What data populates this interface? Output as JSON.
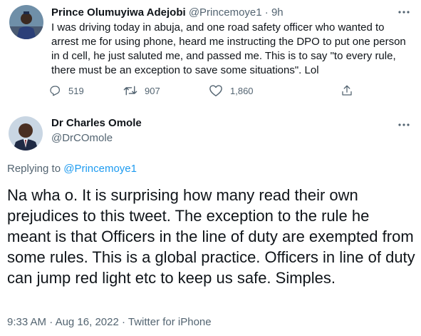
{
  "tweet1": {
    "author_name": "Prince Olumuyiwa Adejobi",
    "handle": "@Princemoye1",
    "separator": "·",
    "time": "9h",
    "text": "I was driving today in abuja, and one road safety officer who wanted to arrest me for using phone, heard me instructing the DPO to put one person in d cell, he just saluted me, and passed me. This is to say \"to every rule, there must be an exception to save some situations\". Lol",
    "reply_count": "519",
    "retweet_count": "907",
    "like_count": "1,860"
  },
  "tweet2": {
    "author_name": "Dr Charles Omole",
    "handle": "@DrCOmole",
    "replying_prefix": "Replying to",
    "replying_handle": "@Princemoye1",
    "text": "Na wha o. It is surprising how many read their own prejudices to this tweet. The exception to the rule he meant is that Officers in the line of duty are exempted from some rules. This is a global practice. Officers in line of duty can jump red light etc to keep us safe. Simples.",
    "time": "9:33 AM",
    "separator": "·",
    "date": "Aug 16, 2022",
    "source": "Twitter for iPhone"
  },
  "colors": {
    "text_primary": "#0f1419",
    "text_secondary": "#536471",
    "link": "#1d9bf0"
  },
  "icons": [
    "more-icon",
    "reply-icon",
    "retweet-icon",
    "like-icon",
    "share-icon"
  ]
}
